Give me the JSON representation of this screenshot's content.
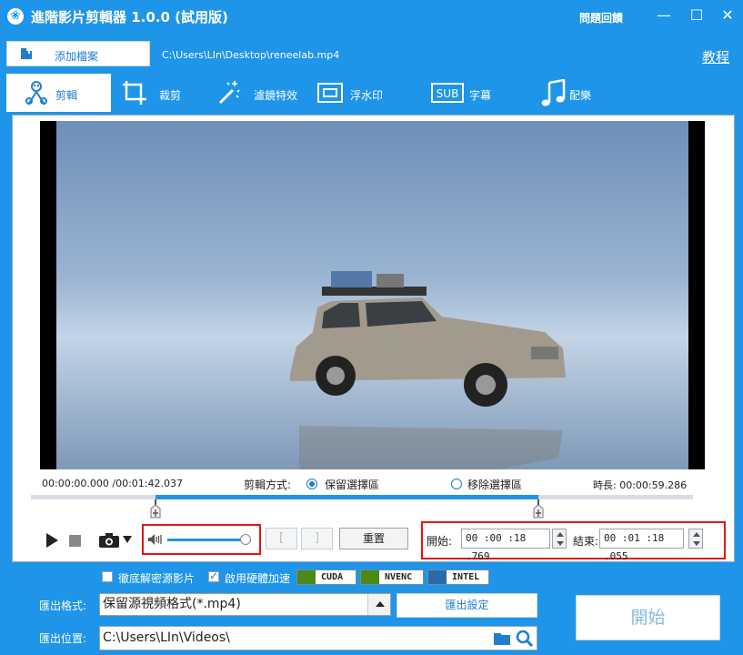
{
  "titlebar": {
    "title": "進階影片剪輯器 1.0.0 (試用版)",
    "feedback": "問題回饋",
    "minimize": "—",
    "maximize": "☐",
    "close": "✕"
  },
  "toolbar": {
    "add_file": "添加檔案",
    "file_path": "C:\\Users\\LIn\\Desktop\\reneelab.mp4",
    "tutorial": "教程"
  },
  "tabs": [
    {
      "label": "剪輯",
      "icon": "scissors-film-icon",
      "active": true
    },
    {
      "label": "裁剪",
      "icon": "crop-icon",
      "active": false
    },
    {
      "label": "濾鏡特效",
      "icon": "magic-wand-icon",
      "active": false
    },
    {
      "label": "浮水印",
      "icon": "watermark-icon",
      "active": false
    },
    {
      "label": "字幕",
      "icon": "subtitle-icon",
      "active": false
    },
    {
      "label": "配樂",
      "icon": "music-note-icon",
      "active": false
    }
  ],
  "subtitle_icon_text": "SUB",
  "player": {
    "position": "00:00:00.000 /00:01:42.037",
    "mode_label": "剪輯方式:",
    "mode_keep": "保留選擇區",
    "mode_remove": "移除選擇區",
    "mode_selected": "keep",
    "duration_label": "時長:",
    "duration_value": "00:00:59.286",
    "selection_start_fraction": 0.188,
    "selection_end_fraction": 0.766,
    "volume_fraction": 0.93
  },
  "controls": {
    "bracket_left": "[",
    "bracket_right": "]",
    "reset": "重置",
    "start_label": "開始:",
    "start_value": "00 :00 :18 .769",
    "end_label": "結束:",
    "end_value": "00 :01 :18 .055"
  },
  "options": {
    "decrypt_label": "徹底解密源影片",
    "decrypt_checked": false,
    "hwaccel_label": "啟用硬體加速",
    "hwaccel_checked": true,
    "cuda": "CUDA",
    "nvenc": "NVENC",
    "intel": "INTEL"
  },
  "export": {
    "format_label": "匯出格式:",
    "format_value": "保留源視頻格式(*.mp4)",
    "settings_button": "匯出設定",
    "location_label": "匯出位置:",
    "location_value": "C:\\Users\\LIn\\Videos\\",
    "start_button": "開始"
  },
  "colors": {
    "brand_blue": "#1e95e8",
    "highlight_red": "#e01818"
  }
}
